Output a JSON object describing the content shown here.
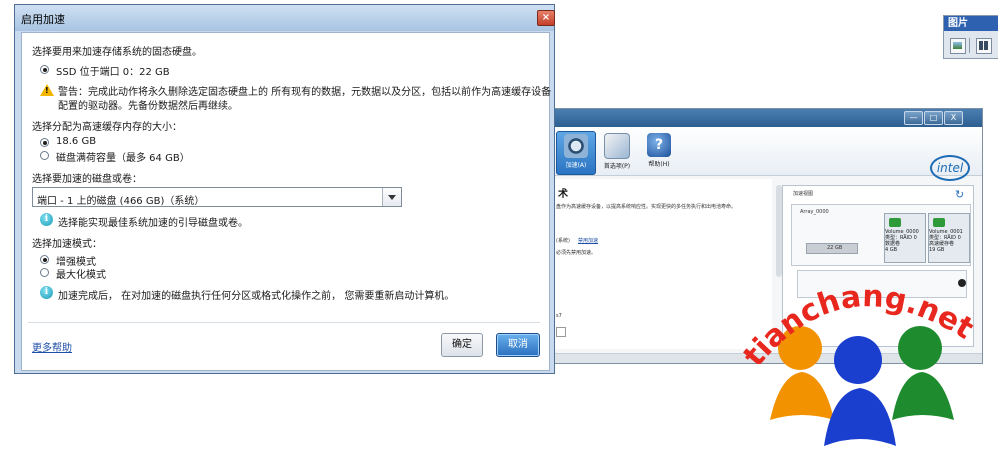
{
  "dialog": {
    "title": "启用加速",
    "close_label": "×",
    "ssd_section_label": "选择要用来加速存储系统的固态硬盘。",
    "ssd_option": "SSD 位于端口 0：22 GB",
    "warning_line1": "警告：完成此动作将永久删除选定固态硬盘上的 所有现有的数据，元数据以及分区，包括以前作为高速缓存设备",
    "warning_line2": "配置的驱动器。先备份数据然后再继续。",
    "cache_size_label": "选择分配为高速缓存内存的大小：",
    "cache_options": [
      "18.6 GB",
      "磁盘满荷容量（最多 64 GB）"
    ],
    "disk_label": "选择要加速的磁盘或卷：",
    "disk_selected": "端口 - 1 上的磁盘 (466 GB)（系统）",
    "disk_hint": "选择能实现最佳系统加速的引导磁盘或卷。",
    "mode_label": "选择加速模式：",
    "mode_options": [
      "增强模式",
      "最大化模式"
    ],
    "restart_note": "加速完成后， 在对加速的磁盘执行任何分区或格式化操作之前， 您需要重新启动计算机。",
    "help_link": "更多帮助",
    "ok_label": "确定",
    "cancel_label": "取消"
  },
  "background_window": {
    "window_buttons": [
      "—",
      "□",
      "X"
    ],
    "toolbar": [
      {
        "label": "加速(A)",
        "icon": "accelerate-icon",
        "selected": true
      },
      {
        "label": "首选项(P)",
        "icon": "preferences-icon",
        "selected": false
      },
      {
        "label": "帮助(H)",
        "icon": "help-icon",
        "selected": false
      }
    ],
    "brand": "intel",
    "heading": "术",
    "desc_line": "盘作为高速缓存设备，以提高系统响应性。实现更快的多任务执行和出电池寿命。",
    "link_line_prefix": "(系统)",
    "link_line_link": "禁用加速",
    "link_line2": "必须先禁用加速。",
    "fragment_s7": "s7",
    "panel_title": "加速视图",
    "array_label": "Array_0000",
    "disk_size": "22 GB",
    "volumes": [
      {
        "name": "Volume_0000",
        "type": "类型：RAID 0",
        "role": "数据卷",
        "size": "4 GB"
      },
      {
        "name": "Volume_0001",
        "type": "类型：RAID 0",
        "role": "高速缓存卷",
        "size": "19 GB"
      }
    ]
  },
  "picture_toolbar": {
    "title": "图片"
  },
  "watermark": {
    "text": "tianchang.net",
    "colors": {
      "text": "#e8281e",
      "orange": "#f39200",
      "blue": "#1a3fcf",
      "green": "#1e8c2e"
    }
  }
}
